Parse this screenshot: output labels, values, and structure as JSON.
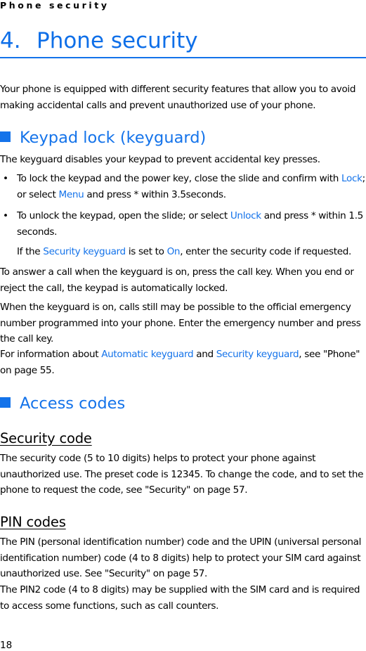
{
  "running_head": "Phone security",
  "chapter": {
    "number": "4.",
    "title": "Phone security"
  },
  "intro": "Your phone is equipped with different security features that allow you to avoid making accidental calls and prevent unauthorized use of your phone.",
  "keypad_lock": {
    "heading": "Keypad lock (keyguard)",
    "lead": "The keyguard disables your keypad to prevent accidental key presses.",
    "bullet1": {
      "a": "To lock the keypad and the power key, close the slide and confirm with ",
      "lock": "Lock",
      "b": "; or select ",
      "menu": "Menu",
      "c": " and press * within 3.5seconds."
    },
    "bullet2": {
      "a": "To unlock the keypad, open the slide; or select ",
      "unlock": "Unlock",
      "b": " and press * within 1.5 seconds."
    },
    "note": {
      "a": "If the ",
      "security_keyguard": "Security keyguard",
      "b": " is set to ",
      "on": "On",
      "c": ", enter the security code if requested."
    },
    "answer_call": "To answer a call when the keyguard is on, press the call key. When you end or reject the call, the keypad is automatically locked.",
    "emergency": "When the keyguard is on, calls still may be possible to the official emergency number programmed into your phone. Enter the emergency number and press the call key.",
    "more_info": {
      "a": "For information about ",
      "automatic_keyguard": "Automatic keyguard",
      "b": " and ",
      "security_keyguard": "Security keyguard",
      "c": ", see \"Phone\" on page 55."
    }
  },
  "access_codes": {
    "heading": "Access codes",
    "security_code": {
      "heading": "Security code",
      "text": "The security code (5 to 10 digits) helps to protect your phone against unauthorized use. The preset code is 12345. To change the code, and to set the phone to request the code, see \"Security\" on page 57."
    },
    "pin_codes": {
      "heading": "PIN codes",
      "text1": "The PIN (personal identification number) code and the UPIN (universal personal identification number) code (4 to 8 digits) help to protect your SIM card against unauthorized use. See \"Security\" on page 57.",
      "text2": "The PIN2 code (4 to 8 digits) may be supplied with the SIM card and is required to access some functions, such as call counters."
    }
  },
  "page_number": "18",
  "colors": {
    "accent": "#1473ea",
    "text": "#000000"
  }
}
